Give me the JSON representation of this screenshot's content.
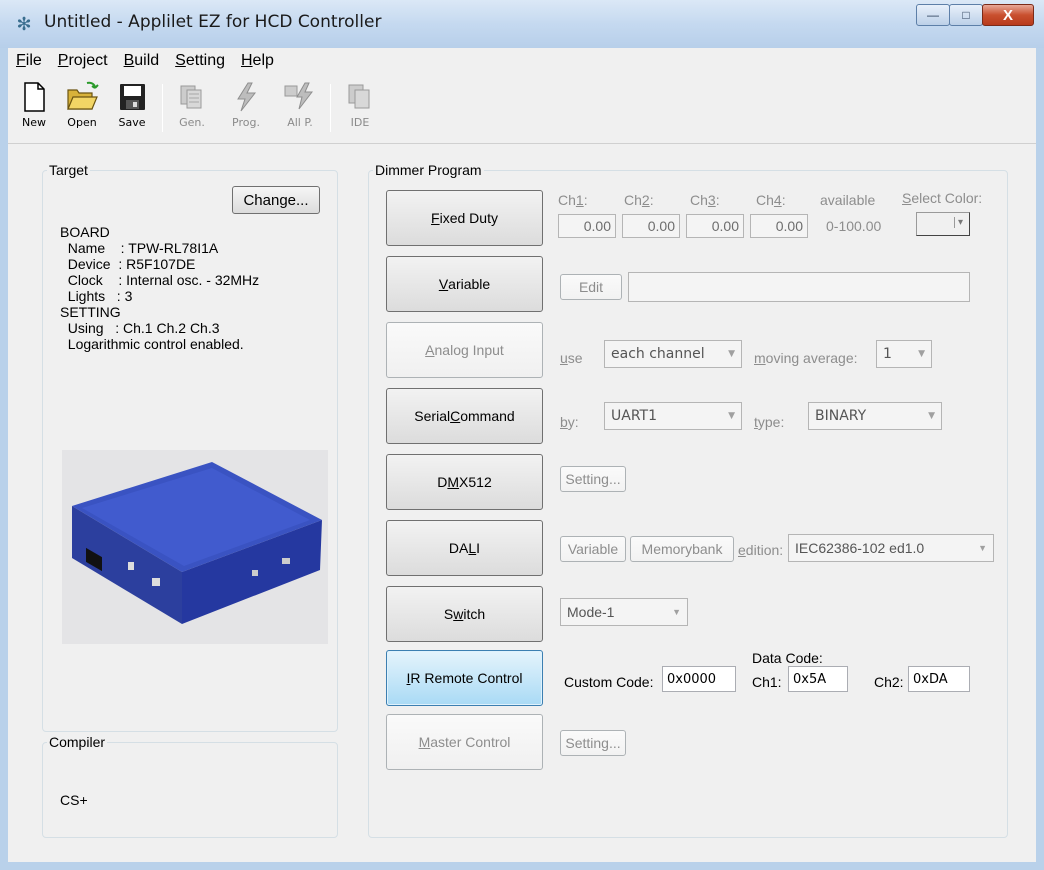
{
  "window": {
    "title": "Untitled - Applilet EZ for HCD Controller",
    "controls": {
      "minimize": "—",
      "maximize": "□",
      "close": "X"
    }
  },
  "menu": [
    {
      "pre": "",
      "u": "F",
      "post": "ile"
    },
    {
      "pre": "",
      "u": "P",
      "post": "roject"
    },
    {
      "pre": "",
      "u": "B",
      "post": "uild"
    },
    {
      "pre": "",
      "u": "S",
      "post": "etting"
    },
    {
      "pre": "",
      "u": "H",
      "post": "elp"
    }
  ],
  "toolbar": {
    "new": "New",
    "open": "Open",
    "save": "Save",
    "gen": "Gen.",
    "prog": "Prog.",
    "allp": "All P.",
    "ide": "IDE"
  },
  "target": {
    "legend": "Target",
    "change_label": "Change...",
    "lines": [
      "BOARD",
      "  Name    : TPW-RL78I1A",
      "  Device  : R5F107DE",
      "  Clock    : Internal osc. - 32MHz",
      "  Lights   : 3",
      "SETTING",
      "  Using   : Ch.1 Ch.2 Ch.3",
      "  Logarithmic control enabled."
    ]
  },
  "compiler": {
    "legend": "Compiler",
    "value": "CS+"
  },
  "dimmer": {
    "legend": "Dimmer Program",
    "fixed_duty": {
      "label_pre": "",
      "label_u": "F",
      "label_post": "ixed Duty",
      "ch1_pre": "Ch",
      "ch1_u": "1",
      "ch1_post": ":",
      "ch2_pre": "Ch",
      "ch2_u": "2",
      "ch2_post": ":",
      "ch3_pre": "Ch",
      "ch3_u": "3",
      "ch3_post": ":",
      "ch4_pre": "Ch",
      "ch4_u": "4",
      "ch4_post": ":",
      "ch1": "0.00",
      "ch2": "0.00",
      "ch3": "0.00",
      "ch4": "0.00",
      "available_label": "available",
      "available_range": "0-100.00",
      "select_color_u": "S",
      "select_color_post": "elect Color:"
    },
    "variable": {
      "label_pre": "",
      "label_u": "V",
      "label_post": "ariable",
      "edit_label": "Edit",
      "value": ""
    },
    "analog_input": {
      "label_pre": "",
      "label_u": "A",
      "label_post": "nalog Input",
      "use_u": "u",
      "use_post": "se",
      "use_value": "each channel",
      "moving_u": "m",
      "moving_post": "oving average:",
      "moving_value": "1"
    },
    "serial_command": {
      "label_pre": "Serial ",
      "label_u": "C",
      "label_post": "ommand",
      "by_u": "b",
      "by_post": "y:",
      "by_value": "UART1",
      "type_u": "t",
      "type_post": "ype:",
      "type_value": "BINARY"
    },
    "dmx512": {
      "label_pre": "D",
      "label_u": "M",
      "label_post": "X512",
      "setting_label": "Setting..."
    },
    "dali": {
      "label_pre": "DA",
      "label_u": "L",
      "label_post": "I",
      "variable_label": "Variable",
      "memorybank_label": "Memorybank",
      "edition_u": "e",
      "edition_post": "dition:",
      "edition_value": "IEC62386-102 ed1.0"
    },
    "switch": {
      "label_pre": "S",
      "label_u": "w",
      "label_post": "itch",
      "mode_value": "Mode-1"
    },
    "ir_remote": {
      "label_pre": "",
      "label_u": "I",
      "label_post": "R Remote Control",
      "custom_code_label": "Custom Code:",
      "custom_code_value": "0x0000",
      "data_code_label": "Data Code:",
      "ch1_label": "Ch1:",
      "ch1_value": "0x5A",
      "ch2_label": "Ch2:",
      "ch2_value": "0xDA"
    },
    "master_control": {
      "label_pre": "",
      "label_u": "M",
      "label_post": "aster Control",
      "setting_label": "Setting..."
    }
  }
}
